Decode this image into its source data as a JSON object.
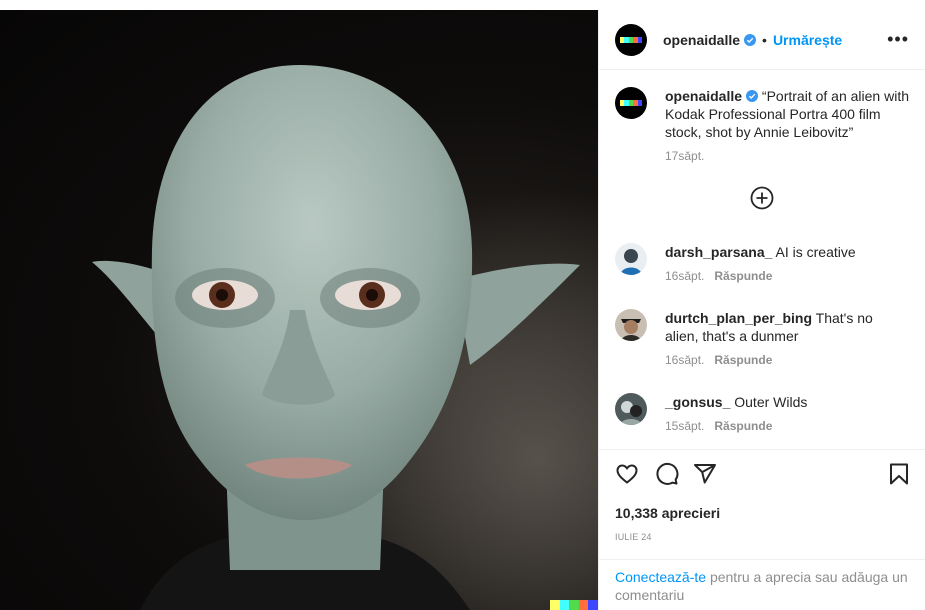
{
  "post": {
    "author": "openaidalle",
    "follow_label": "Urmărește",
    "separator": "•",
    "more_label": "•••",
    "caption": "“Portrait of an alien with Kodak Professional Portra 400 film stock, shot by Annie Leibovitz”",
    "caption_age": "17săpt.",
    "likes": "10,338 aprecieri",
    "date": "IULIE 24"
  },
  "comments": [
    {
      "user": "darsh_parsana_",
      "text": "AI is creative",
      "age": "16săpt.",
      "reply": "Răspunde"
    },
    {
      "user": "durtch_plan_per_bing",
      "text": "That's no alien, that's a dunmer",
      "age": "16săpt.",
      "reply": "Răspunde"
    },
    {
      "user": "_gonsus_",
      "text": "Outer Wilds",
      "age": "15săpt.",
      "reply": "Răspunde"
    }
  ],
  "login": {
    "link": "Conectează-te",
    "rest": " pentru a aprecia sau adăuga un comentariu"
  },
  "colors": {
    "accent": "#0095f6",
    "verified": "#3897f0",
    "muted": "#8e8e8e",
    "dalle_strip": [
      "#ffff66",
      "#42ffff",
      "#51da4c",
      "#ff6e3c",
      "#3c46ff"
    ]
  },
  "icons": [
    "more-icon",
    "verified-icon",
    "add-comment-icon",
    "like-icon",
    "comment-icon",
    "share-icon",
    "save-icon"
  ]
}
